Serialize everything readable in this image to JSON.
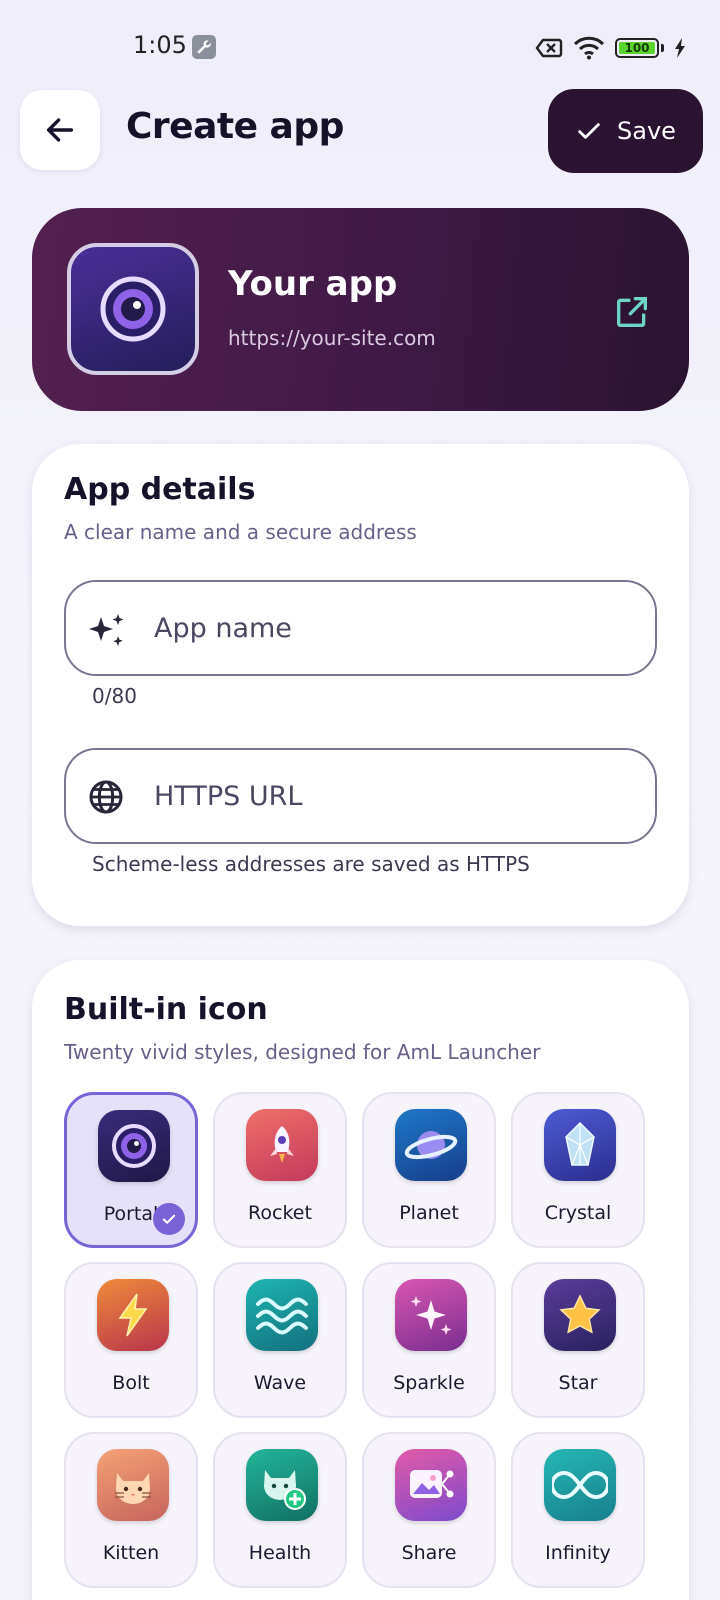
{
  "status_bar": {
    "time": "1:05",
    "battery": "100"
  },
  "header": {
    "title": "Create app",
    "save_label": "Save"
  },
  "preview": {
    "name": "Your app",
    "url": "https://your-site.com"
  },
  "details": {
    "title": "App details",
    "subtitle": "A clear name and a secure address",
    "name_placeholder": "App name",
    "name_counter": "0/80",
    "url_placeholder": "HTTPS URL",
    "url_helper": "Scheme-less addresses are saved as HTTPS"
  },
  "icons": {
    "title": "Built-in icon",
    "subtitle": "Twenty vivid styles, designed for AmL Launcher",
    "selected": "Portal",
    "items": [
      {
        "label": "Portal"
      },
      {
        "label": "Rocket"
      },
      {
        "label": "Planet"
      },
      {
        "label": "Crystal"
      },
      {
        "label": "Bolt"
      },
      {
        "label": "Wave"
      },
      {
        "label": "Sparkle"
      },
      {
        "label": "Star"
      },
      {
        "label": "Kitten"
      },
      {
        "label": "Health"
      },
      {
        "label": "Share"
      },
      {
        "label": "Infinity"
      }
    ]
  }
}
